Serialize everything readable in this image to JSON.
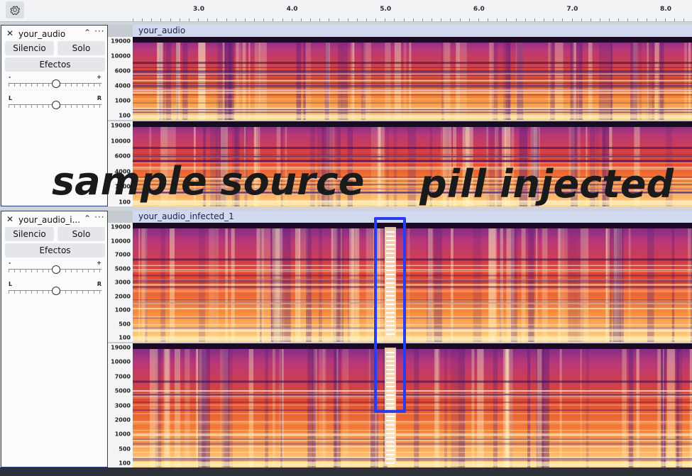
{
  "timeline": {
    "settings_icon": "gear-icon",
    "ticks": [
      "3.0",
      "4.0",
      "5.0",
      "6.0",
      "7.0",
      "8.0"
    ]
  },
  "tracks": [
    {
      "name": "your_audio",
      "clip_name": "your_audio",
      "mute_label": "Silencio",
      "solo_label": "Solo",
      "effects_label": "Efectos",
      "gain_min": "-",
      "gain_max": "+",
      "pan_left": "L",
      "pan_right": "R",
      "gain_level": 0.5,
      "pan_level": 0.5,
      "channel_scales": [
        [
          "19000",
          "10000",
          "6000",
          "4000",
          "1000",
          "100"
        ],
        [
          "19000",
          "10000",
          "6000",
          "4000",
          "1000",
          "100"
        ]
      ]
    },
    {
      "name": "your_audio_i...",
      "clip_name": "your_audio_infected_1",
      "mute_label": "Silencio",
      "solo_label": "Solo",
      "effects_label": "Efectos",
      "gain_min": "-",
      "gain_max": "+",
      "pan_left": "L",
      "pan_right": "R",
      "gain_level": 0.5,
      "pan_level": 0.5,
      "channel_scales": [
        [
          "19000",
          "10000",
          "7000",
          "5000",
          "3000",
          "2000",
          "1000",
          "500",
          "100"
        ],
        [
          "19000",
          "10000",
          "7000",
          "5000",
          "3000",
          "2000",
          "1000",
          "500",
          "100"
        ]
      ]
    }
  ],
  "annotations": {
    "left_label": "sample source",
    "right_label": "pill injected",
    "highlight_color": "#2a3cf0"
  },
  "colors": {
    "spectrogram_low": "#e0452c",
    "spectrogram_mid": "#f7a35c",
    "spectrogram_high": "#fff5d0",
    "spectrogram_dark": "#5a1f7a"
  }
}
